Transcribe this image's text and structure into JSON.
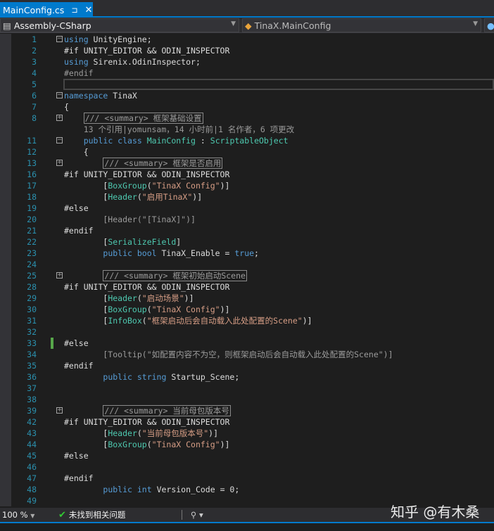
{
  "tab": {
    "title": "MainConfig.cs",
    "pin": "⊐",
    "close": "✕"
  },
  "nav": {
    "project": "Assembly-CSharp",
    "type": "TinaX.MainConfig"
  },
  "lines": [
    {
      "n": "1",
      "fold": "−",
      "t": [
        [
          "kw",
          "using"
        ],
        [
          "",
          " UnityEngine;"
        ]
      ]
    },
    {
      "n": "2",
      "t": [
        [
          "",
          "#if UNITY_EDITOR && ODIN_INSPECTOR"
        ]
      ]
    },
    {
      "n": "3",
      "t": [
        [
          "kw",
          "using"
        ],
        [
          "",
          " Sirenix.OdinInspector;"
        ]
      ]
    },
    {
      "n": "4",
      "t": [
        [
          "pp",
          "#endif"
        ]
      ]
    },
    {
      "n": "5",
      "cursor": true,
      "t": []
    },
    {
      "n": "6",
      "fold": "−",
      "t": [
        [
          "kw",
          "namespace"
        ],
        [
          "",
          " TinaX"
        ]
      ]
    },
    {
      "n": "7",
      "t": [
        [
          "",
          "{"
        ]
      ]
    },
    {
      "n": "8",
      "fold": "+",
      "t": [
        [
          "",
          "    "
        ],
        [
          "box",
          "/// <summary> 框架基础设置"
        ]
      ]
    },
    {
      "n": "",
      "t": [
        [
          "lens",
          "    13 个引用|yomunsam，14 小时前|1 名作者，6 项更改"
        ]
      ]
    },
    {
      "n": "11",
      "fold": "−",
      "t": [
        [
          "",
          "    "
        ],
        [
          "kw",
          "public class"
        ],
        [
          "",
          " "
        ],
        [
          "ty",
          "MainConfig"
        ],
        [
          "",
          " : "
        ],
        [
          "ty",
          "ScriptableObject"
        ]
      ]
    },
    {
      "n": "12",
      "t": [
        [
          "",
          "    {"
        ]
      ]
    },
    {
      "n": "13",
      "fold": "+",
      "t": [
        [
          "",
          "        "
        ],
        [
          "box",
          "/// <summary> 框架是否启用"
        ]
      ]
    },
    {
      "n": "16",
      "t": [
        [
          "",
          "#if UNITY_EDITOR && ODIN_INSPECTOR"
        ]
      ]
    },
    {
      "n": "17",
      "t": [
        [
          "",
          "        ["
        ],
        [
          "ty",
          "BoxGroup"
        ],
        [
          "",
          "("
        ],
        [
          "st",
          "\"TinaX Config\""
        ],
        [
          "",
          ")]"
        ]
      ]
    },
    {
      "n": "18",
      "t": [
        [
          "",
          "        ["
        ],
        [
          "ty",
          "Header"
        ],
        [
          "",
          "("
        ],
        [
          "st",
          "\"启用TinaX\""
        ],
        [
          "",
          ")]"
        ]
      ]
    },
    {
      "n": "19",
      "t": [
        [
          "",
          "#else"
        ]
      ]
    },
    {
      "n": "20",
      "t": [
        [
          "gr",
          "        [Header(\"[TinaX]\")]"
        ]
      ]
    },
    {
      "n": "21",
      "t": [
        [
          "",
          "#endif"
        ]
      ]
    },
    {
      "n": "22",
      "t": [
        [
          "",
          "        ["
        ],
        [
          "ty",
          "SerializeField"
        ],
        [
          "",
          "]"
        ]
      ]
    },
    {
      "n": "23",
      "t": [
        [
          "",
          "        "
        ],
        [
          "kw",
          "public bool"
        ],
        [
          "",
          " TinaX_Enable = "
        ],
        [
          "kw",
          "true"
        ],
        [
          "",
          ";"
        ]
      ]
    },
    {
      "n": "24",
      "t": []
    },
    {
      "n": "25",
      "fold": "+",
      "t": [
        [
          "",
          "        "
        ],
        [
          "box",
          "/// <summary> 框架初始启动Scene"
        ]
      ]
    },
    {
      "n": "28",
      "t": [
        [
          "",
          "#if UNITY_EDITOR && ODIN_INSPECTOR"
        ]
      ]
    },
    {
      "n": "29",
      "t": [
        [
          "",
          "        ["
        ],
        [
          "ty",
          "Header"
        ],
        [
          "",
          "("
        ],
        [
          "st",
          "\"启动场景\""
        ],
        [
          "",
          ")]"
        ]
      ]
    },
    {
      "n": "30",
      "t": [
        [
          "",
          "        ["
        ],
        [
          "ty",
          "BoxGroup"
        ],
        [
          "",
          "("
        ],
        [
          "st",
          "\"TinaX Config\""
        ],
        [
          "",
          ")]"
        ]
      ]
    },
    {
      "n": "31",
      "t": [
        [
          "",
          "        ["
        ],
        [
          "ty",
          "InfoBox"
        ],
        [
          "",
          "("
        ],
        [
          "st",
          "\"框架启动后会自动载入此处配置的Scene\""
        ],
        [
          "",
          ")]"
        ]
      ]
    },
    {
      "n": "32",
      "t": []
    },
    {
      "n": "33",
      "change": true,
      "t": [
        [
          "",
          "#else"
        ]
      ]
    },
    {
      "n": "34",
      "t": [
        [
          "gr",
          "        [Tooltip(\"如配置内容不为空，则框架启动后会自动载入此处配置的Scene\")]"
        ]
      ]
    },
    {
      "n": "35",
      "t": [
        [
          "",
          "#endif"
        ]
      ]
    },
    {
      "n": "36",
      "t": [
        [
          "",
          "        "
        ],
        [
          "kw",
          "public string"
        ],
        [
          "",
          " Startup_Scene;"
        ]
      ]
    },
    {
      "n": "37",
      "t": []
    },
    {
      "n": "38",
      "t": []
    },
    {
      "n": "39",
      "fold": "+",
      "t": [
        [
          "",
          "        "
        ],
        [
          "box",
          "/// <summary> 当前母包版本号"
        ]
      ]
    },
    {
      "n": "42",
      "t": [
        [
          "",
          "#if UNITY_EDITOR && ODIN_INSPECTOR"
        ]
      ]
    },
    {
      "n": "43",
      "t": [
        [
          "",
          "        ["
        ],
        [
          "ty",
          "Header"
        ],
        [
          "",
          "("
        ],
        [
          "st",
          "\"当前母包版本号\""
        ],
        [
          "",
          ")]"
        ]
      ]
    },
    {
      "n": "44",
      "t": [
        [
          "",
          "        ["
        ],
        [
          "ty",
          "BoxGroup"
        ],
        [
          "",
          "("
        ],
        [
          "st",
          "\"TinaX Config\""
        ],
        [
          "",
          ")]"
        ]
      ]
    },
    {
      "n": "45",
      "t": [
        [
          "",
          "#else"
        ]
      ]
    },
    {
      "n": "46",
      "t": []
    },
    {
      "n": "47",
      "t": [
        [
          "",
          "#endif"
        ]
      ]
    },
    {
      "n": "48",
      "t": [
        [
          "",
          "        "
        ],
        [
          "kw",
          "public int"
        ],
        [
          "",
          " Version_Code = 0;"
        ]
      ]
    },
    {
      "n": "49",
      "t": []
    }
  ],
  "status": {
    "zoom": "100 %",
    "issues": "未找到相关问题"
  },
  "watermark": "知乎 @有木桑",
  "colors": {
    "accent": "#007acc",
    "keyword": "#569cd6",
    "type": "#4ec9b0",
    "string": "#d69d85"
  }
}
